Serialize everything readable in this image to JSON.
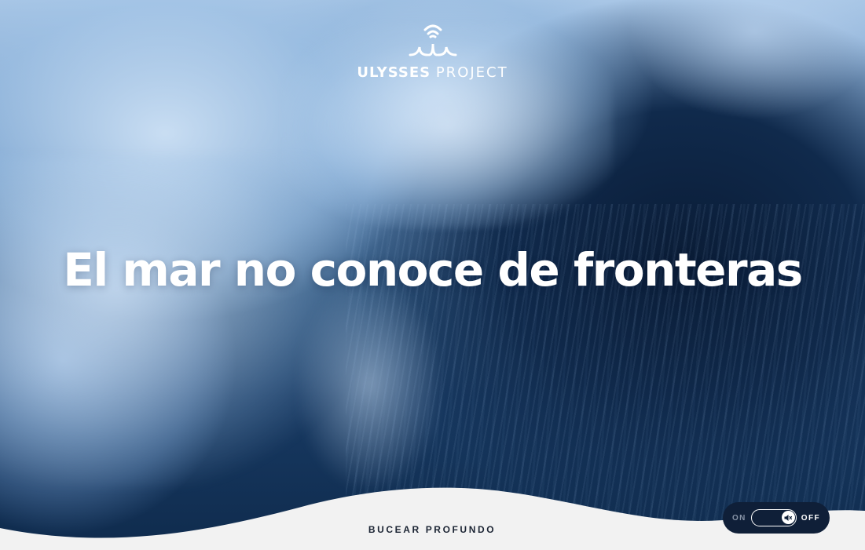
{
  "logo": {
    "name_bold": "ULYSSES",
    "name_light": "PROJECT",
    "icon": "wave-signal-icon"
  },
  "hero": {
    "headline": "El mar no conoce de fronteras"
  },
  "footer": {
    "dive_label": "BUCEAR PROFUNDO"
  },
  "sound_toggle": {
    "on_label": "ON",
    "off_label": "OFF",
    "state": "off",
    "icon": "speaker-muted-icon"
  },
  "colors": {
    "footer_background": "#f2f2f2",
    "toggle_background": "#0f1f38",
    "text_dark": "#1b2433",
    "text_light": "#ffffff"
  }
}
